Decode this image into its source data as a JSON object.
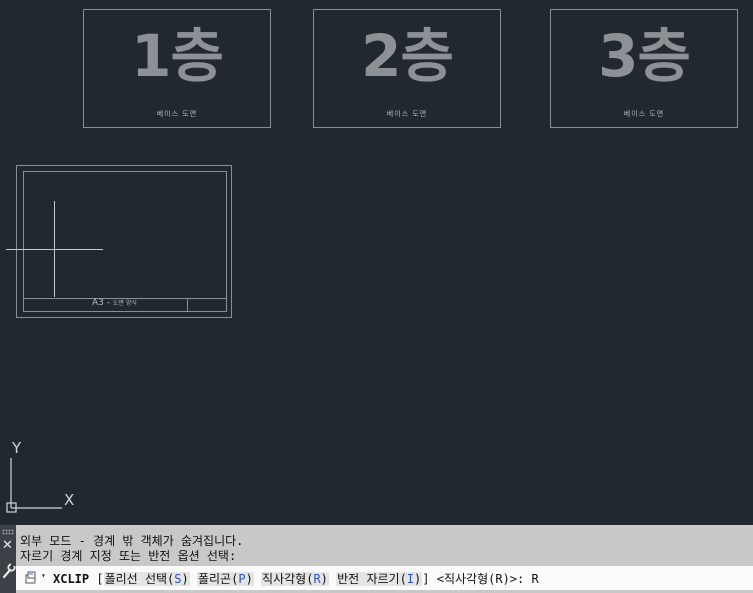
{
  "sheets": [
    {
      "big": "1층",
      "caption": "베이스 도면"
    },
    {
      "big": "2층",
      "caption": "베이스 도면"
    },
    {
      "big": "3층",
      "caption": "베이스 도면"
    }
  ],
  "layout": {
    "title_main": "A3 -",
    "title_sub": "도면 양식"
  },
  "ucs": {
    "y": "Y",
    "x": "X"
  },
  "command": {
    "history": [
      "외부 모드 - 경계 밖 객체가 숨겨집니다.",
      "자르기 경계 지정 또는 반전 옵션 선택:"
    ],
    "name": "XCLIP",
    "bracket_open": "[",
    "options": [
      {
        "label": "폴리선 선택",
        "key": "S"
      },
      {
        "label": "폴리곤",
        "key": "P"
      },
      {
        "label": "직사각형",
        "key": "R"
      },
      {
        "label": "반전 자르기",
        "key": "I"
      }
    ],
    "bracket_close": "]",
    "default": "<직사각형(R)>:",
    "input": "R"
  },
  "colors": {
    "canvas": "#212830",
    "lines": "#8a8f95",
    "option_key": "#2a52c0"
  }
}
